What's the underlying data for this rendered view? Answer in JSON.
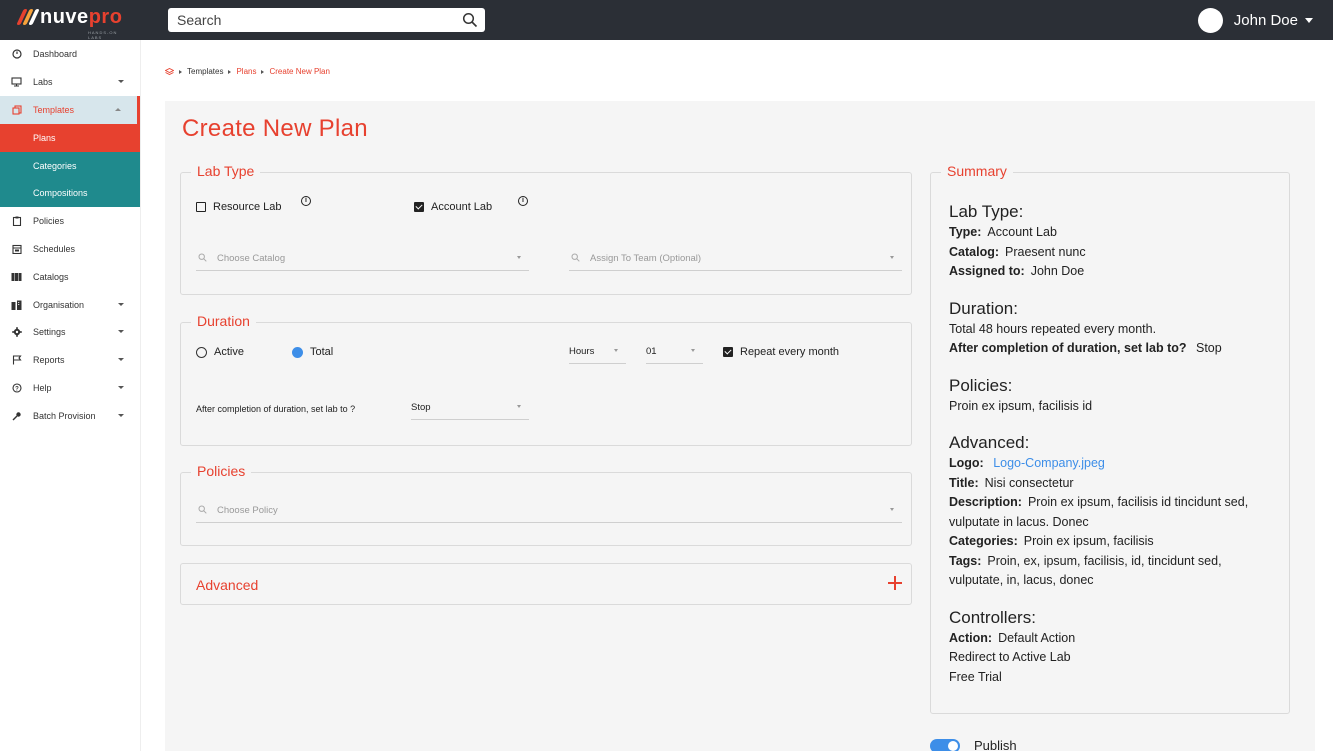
{
  "brand": {
    "name_a": "nuve",
    "name_b": "pro",
    "tagline": "HANDS-ON LABS"
  },
  "search": {
    "placeholder": "Search"
  },
  "user": {
    "name": "John Doe"
  },
  "sidebar": {
    "items": [
      {
        "label": "Dashboard",
        "icon": "dashboard-icon"
      },
      {
        "label": "Labs",
        "icon": "monitor-icon"
      },
      {
        "label": "Templates",
        "icon": "copy-icon"
      },
      {
        "label": "Policies",
        "icon": "clipboard-icon"
      },
      {
        "label": "Schedules",
        "icon": "calendar-icon"
      },
      {
        "label": "Catalogs",
        "icon": "catalog-icon"
      },
      {
        "label": "Organisation",
        "icon": "building-icon"
      },
      {
        "label": "Settings",
        "icon": "gear-icon"
      },
      {
        "label": "Reports",
        "icon": "flag-icon"
      },
      {
        "label": "Help",
        "icon": "help-icon"
      },
      {
        "label": "Batch Provision",
        "icon": "key-icon"
      }
    ],
    "sub_items": [
      "Plans",
      "Categories",
      "Compositions"
    ]
  },
  "breadcrumb": {
    "items": [
      "Templates",
      "Plans",
      "Create New Plan"
    ]
  },
  "page": {
    "title": "Create New Plan"
  },
  "lab_type": {
    "legend": "Lab Type",
    "resource_lab": "Resource Lab",
    "account_lab": "Account Lab",
    "catalog_placeholder": "Choose Catalog",
    "team_placeholder": "Assign To Team (Optional)"
  },
  "duration": {
    "legend": "Duration",
    "active": "Active",
    "total": "Total",
    "unit": "Hours",
    "amount": "01",
    "repeat": "Repeat every month",
    "after_label": "After completion of duration, set lab to ?",
    "after_value": "Stop"
  },
  "policies": {
    "legend": "Policies",
    "placeholder": "Choose Policy"
  },
  "advanced": {
    "label": "Advanced"
  },
  "summary": {
    "legend": "Summary",
    "lab_type": {
      "heading": "Lab Type:",
      "type_k": "Type:",
      "type_v": "Account Lab",
      "catalog_k": "Catalog:",
      "catalog_v": "Praesent nunc",
      "assigned_k": "Assigned to:",
      "assigned_v": "John Doe"
    },
    "duration": {
      "heading": "Duration:",
      "line": "Total 48 hours repeated every month.",
      "after_k": "After completion of duration, set lab to?",
      "after_v": "Stop"
    },
    "policies": {
      "heading": "Policies:",
      "line": "Proin ex ipsum, facilisis id"
    },
    "advanced": {
      "heading": "Advanced:",
      "logo_k": "Logo:",
      "logo_v": "Logo-Company.jpeg",
      "title_k": "Title:",
      "title_v": "Nisi consectetur",
      "desc_k": "Description:",
      "desc_v": "Proin ex ipsum, facilisis id tincidunt sed, vulputate in lacus. Donec",
      "cat_k": "Categories:",
      "cat_v": "Proin ex ipsum, facilisis",
      "tags_k": "Tags:",
      "tags_v": "Proin, ex, ipsum, facilisis, id, tincidunt sed, vulputate, in, lacus, donec"
    },
    "controllers": {
      "heading": "Controllers:",
      "action_k": "Action:",
      "action_v": "Default Action",
      "line2": "Redirect to Active Lab",
      "line3": "Free Trial"
    }
  },
  "publish": {
    "label": "Publish",
    "enabled": true
  },
  "colors": {
    "accent": "#e7412f",
    "teal": "#1f8a8d",
    "topbar": "#2b2f36",
    "blue": "#3d8ee8"
  }
}
